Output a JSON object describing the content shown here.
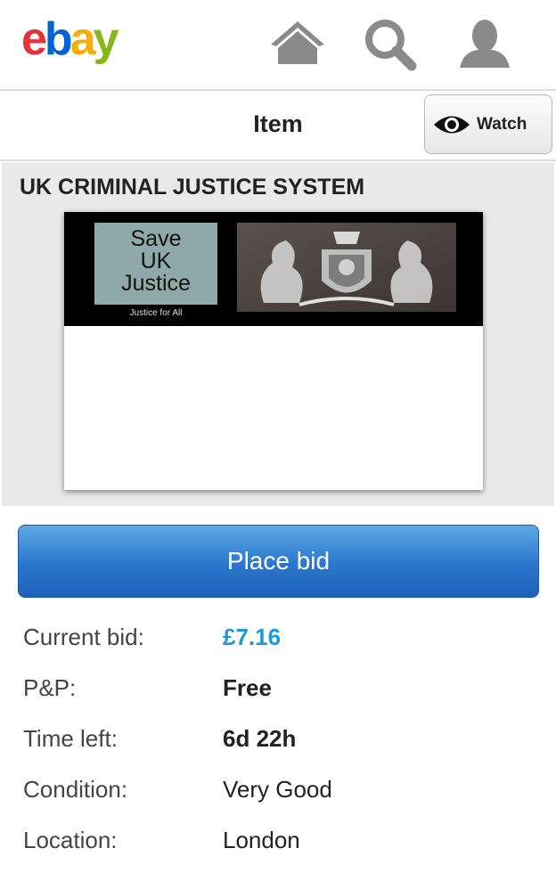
{
  "header": {
    "logo": {
      "e": "e",
      "b": "b",
      "a": "a",
      "y": "y"
    },
    "icons": [
      "home-icon",
      "search-icon",
      "user-icon"
    ]
  },
  "itembar": {
    "title": "Item",
    "watch_label": "Watch"
  },
  "listing": {
    "title": "UK CRIMINAL JUSTICE SYSTEM",
    "image": {
      "line1": "Save",
      "line2": "UK",
      "line3": "Justice",
      "subtitle": "Justice for All"
    }
  },
  "bid_button": "Place bid",
  "details": [
    {
      "label": "Current bid:",
      "value": "£7.16",
      "style": "price"
    },
    {
      "label": "P&P:",
      "value": "Free",
      "style": "bold"
    },
    {
      "label": "Time left:",
      "value": "6d 22h",
      "style": "bold"
    },
    {
      "label": "Condition:",
      "value": "Very Good",
      "style": "normal"
    },
    {
      "label": "Location:",
      "value": "London",
      "style": "normal"
    }
  ],
  "colors": {
    "price": "#1a9ad6",
    "bid_button": "#2a76cc"
  }
}
